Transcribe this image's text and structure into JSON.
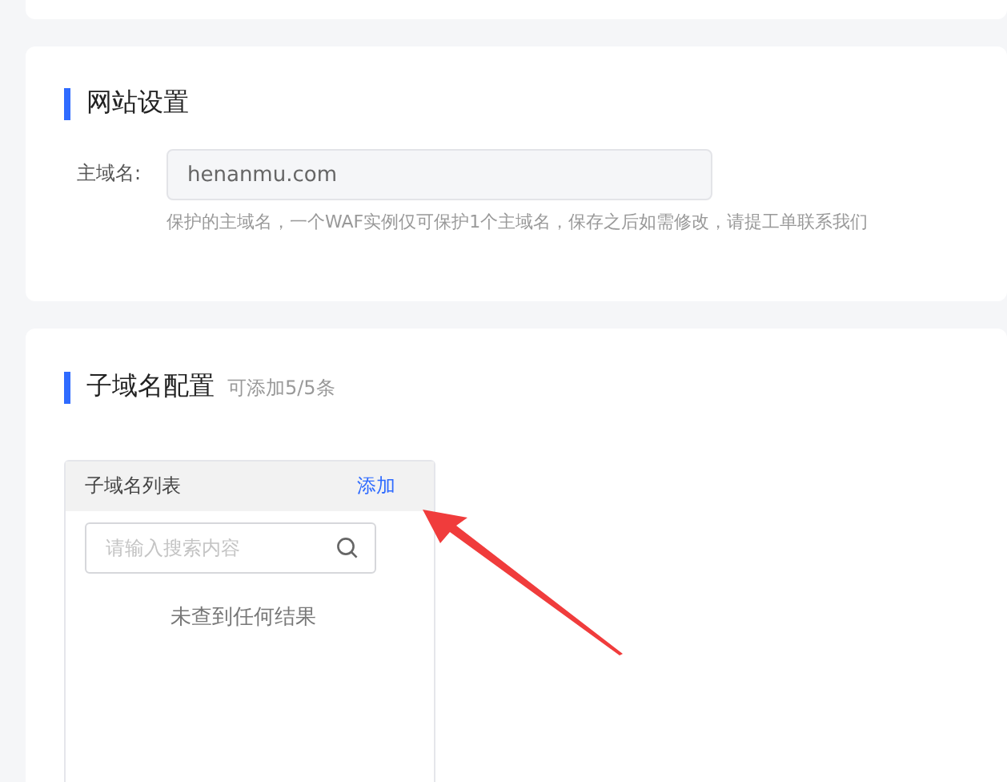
{
  "site_settings": {
    "title": "网站设置",
    "main_domain": {
      "label": "主域名:",
      "value": "henanmu.com",
      "hint": "保护的主域名，一个WAF实例仅可保护1个主域名，保存之后如需修改，请提工单联系我们"
    }
  },
  "subdomain_config": {
    "title": "子域名配置",
    "quota": "可添加5/5条",
    "list": {
      "title": "子域名列表",
      "add_link": "添加",
      "search": {
        "placeholder": "请输入搜索内容"
      },
      "empty_text": "未查到任何结果"
    }
  }
}
